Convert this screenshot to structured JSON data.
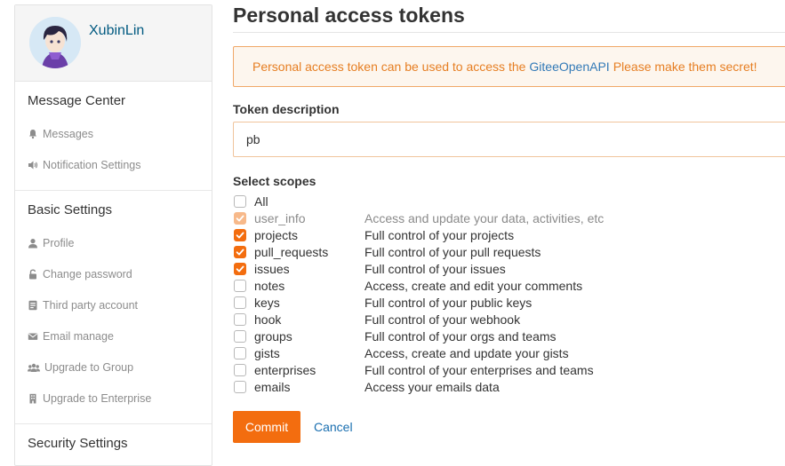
{
  "sidebar": {
    "username": "XubinLin",
    "sections": [
      {
        "title": "Message Center",
        "items": [
          {
            "label": "Messages",
            "icon": "bell-icon"
          },
          {
            "label": "Notification Settings",
            "icon": "speaker-icon"
          }
        ]
      },
      {
        "title": "Basic Settings",
        "items": [
          {
            "label": "Profile",
            "icon": "user-icon"
          },
          {
            "label": "Change password",
            "icon": "unlock-icon"
          },
          {
            "label": "Third party account",
            "icon": "id-card-icon"
          },
          {
            "label": "Email manage",
            "icon": "envelope-icon"
          },
          {
            "label": "Upgrade to Group",
            "icon": "group-icon"
          },
          {
            "label": "Upgrade to Enterprise",
            "icon": "building-icon"
          }
        ]
      },
      {
        "title": "Security Settings",
        "items": []
      }
    ]
  },
  "main": {
    "title": "Personal access tokens",
    "alert": {
      "prefix": "Personal access token can be used to access the",
      "link": "GiteeOpenAPI",
      "suffix": "Please make them secret!"
    },
    "token_label": "Token description",
    "token_value": "pb",
    "scopes_label": "Select scopes",
    "scopes": [
      {
        "name": "All",
        "desc": "",
        "checked": false,
        "disabled": false
      },
      {
        "name": "user_info",
        "desc": "Access and update your data, activities, etc",
        "checked": true,
        "disabled": true
      },
      {
        "name": "projects",
        "desc": "Full control of your projects",
        "checked": true,
        "disabled": false
      },
      {
        "name": "pull_requests",
        "desc": "Full control of your pull requests",
        "checked": true,
        "disabled": false
      },
      {
        "name": "issues",
        "desc": "Full control of your issues",
        "checked": true,
        "disabled": false
      },
      {
        "name": "notes",
        "desc": "Access, create and edit your comments",
        "checked": false,
        "disabled": false
      },
      {
        "name": "keys",
        "desc": "Full control of your public keys",
        "checked": false,
        "disabled": false
      },
      {
        "name": "hook",
        "desc": "Full control of your webhook",
        "checked": false,
        "disabled": false
      },
      {
        "name": "groups",
        "desc": "Full control of your orgs and teams",
        "checked": false,
        "disabled": false
      },
      {
        "name": "gists",
        "desc": "Access, create and update your gists",
        "checked": false,
        "disabled": false
      },
      {
        "name": "enterprises",
        "desc": "Full control of your enterprises and teams",
        "checked": false,
        "disabled": false
      },
      {
        "name": "emails",
        "desc": "Access your emails data",
        "checked": false,
        "disabled": false
      }
    ],
    "commit_label": "Commit",
    "cancel_label": "Cancel"
  },
  "colors": {
    "accent": "#f36d0f",
    "link": "#1a6fb0",
    "alert_text": "#e67e22"
  }
}
